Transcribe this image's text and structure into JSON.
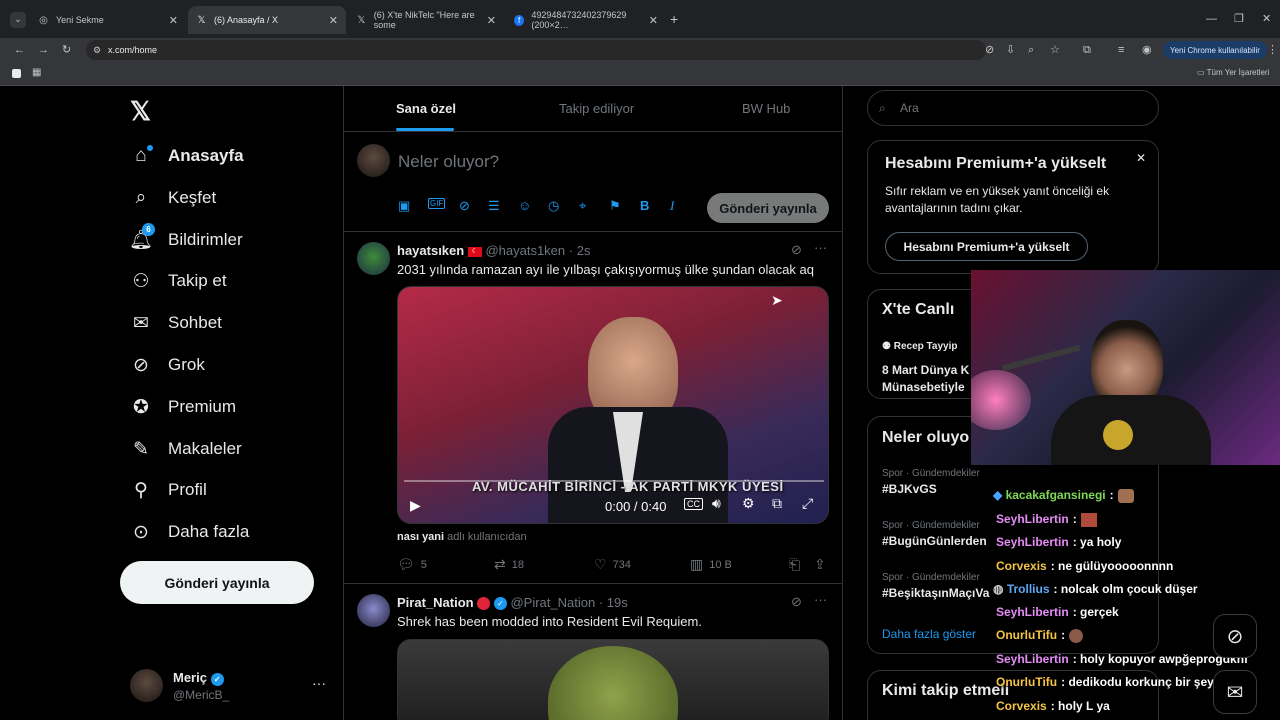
{
  "browser": {
    "tabs": [
      {
        "title": "Yeni Sekme"
      },
      {
        "title": "(6) Anasayfa / X"
      },
      {
        "title": "(6) X'te NikTelc \"Here are some"
      },
      {
        "title": "4929484732402379629 (200×2…"
      }
    ],
    "url": "x.com/home",
    "chrome_update": "Yeni Chrome kullanılabilir",
    "bookmarks_all": "Tüm Yer İşaretleri"
  },
  "nav": {
    "items": [
      {
        "label": "Anasayfa"
      },
      {
        "label": "Keşfet"
      },
      {
        "label": "Bildirimler",
        "badge": "6"
      },
      {
        "label": "Takip et"
      },
      {
        "label": "Sohbet"
      },
      {
        "label": "Grok"
      },
      {
        "label": "Premium"
      },
      {
        "label": "Makaleler"
      },
      {
        "label": "Profil"
      },
      {
        "label": "Daha fazla"
      }
    ],
    "post_button": "Gönderi yayınla",
    "account": {
      "name": "Meriç",
      "handle": "@MericB_"
    }
  },
  "feed": {
    "tabs": [
      "Sana özel",
      "Takip ediliyor",
      "BW Hub"
    ],
    "composer": {
      "placeholder": "Neler oluyor?",
      "button": "Gönderi yayınla"
    },
    "tweets": [
      {
        "name": "hayatsıken",
        "handle": "@hayats1ken",
        "time": "· 2s",
        "text": "2031 yılında ramazan ayı ile yılbaşı çakışıyormuş ülke şundan olacak aq",
        "video": {
          "time": "0:00 / 0:40",
          "caption": "AV. MÜCAHİT BİRİNCİ - AK PARTİ MKYK ÜYESİ"
        },
        "attribution_name": "nası yani",
        "attribution_suffix": "adlı kullanıcıdan",
        "replies": "5",
        "reposts": "18",
        "likes": "734",
        "views": "10 B"
      },
      {
        "name": "Pirat_Nation",
        "handle": "@Pirat_Nation",
        "time": "· 19s",
        "text": "Shrek has been modded into Resident Evil Requiem."
      }
    ]
  },
  "sidebar": {
    "search_placeholder": "Ara",
    "premium": {
      "title": "Hesabını Premium+'a yükselt",
      "body_line1": "Sıfır reklam ve en yüksek yanıt önceliği ek",
      "body_line2": "avantajlarının tadını çıkar.",
      "button": "Hesabını Premium+'a yükselt"
    },
    "live": {
      "title": "X'te Canlı",
      "host": "Recep Tayyip",
      "line1": "8 Mart Dünya K",
      "line2": "Münasebetiyle"
    },
    "trends": {
      "title": "Neler oluyo",
      "items": [
        {
          "context": "Spor · Gündemdekiler",
          "tag": "#BJKvGS"
        },
        {
          "context": "Spor · Gündemdekiler",
          "tag": "#BugünGünlerden"
        },
        {
          "context": "Spor · Gündemdekiler",
          "tag": "#BeşiktaşınMaçıVa"
        }
      ],
      "more": "Daha fazla göster"
    },
    "who_to_follow": "Kimi takip etmeli"
  },
  "chat": [
    {
      "user": "kacakafgansinegi",
      "msg": ":",
      "color": "#7ed957"
    },
    {
      "user": "SeyhLibertin",
      "msg": ":",
      "color": "#e58cf5"
    },
    {
      "user": "SeyhLibertin",
      "msg": ": ya holy",
      "color": "#e58cf5"
    },
    {
      "user": "Corvexis",
      "msg": ": ne gülüyooooonnnn",
      "color": "#f5c542"
    },
    {
      "user": "Trollius",
      "msg": ": nolcak olm çocuk düşer",
      "color": "#5aa9f5"
    },
    {
      "user": "SeyhLibertin",
      "msg": ": gerçek",
      "color": "#e58cf5"
    },
    {
      "user": "OnurluTifu",
      "msg": ":",
      "color": "#f5c542"
    },
    {
      "user": "SeyhLibertin",
      "msg": ": holy kopuyor awpğeprogdkhf",
      "color": "#e58cf5"
    },
    {
      "user": "OnurluTifu",
      "msg": ": dedikodu korkunç bir şey ya",
      "color": "#f5c542"
    },
    {
      "user": "Corvexis",
      "msg": ": holy L ya",
      "color": "#f5c542"
    }
  ]
}
